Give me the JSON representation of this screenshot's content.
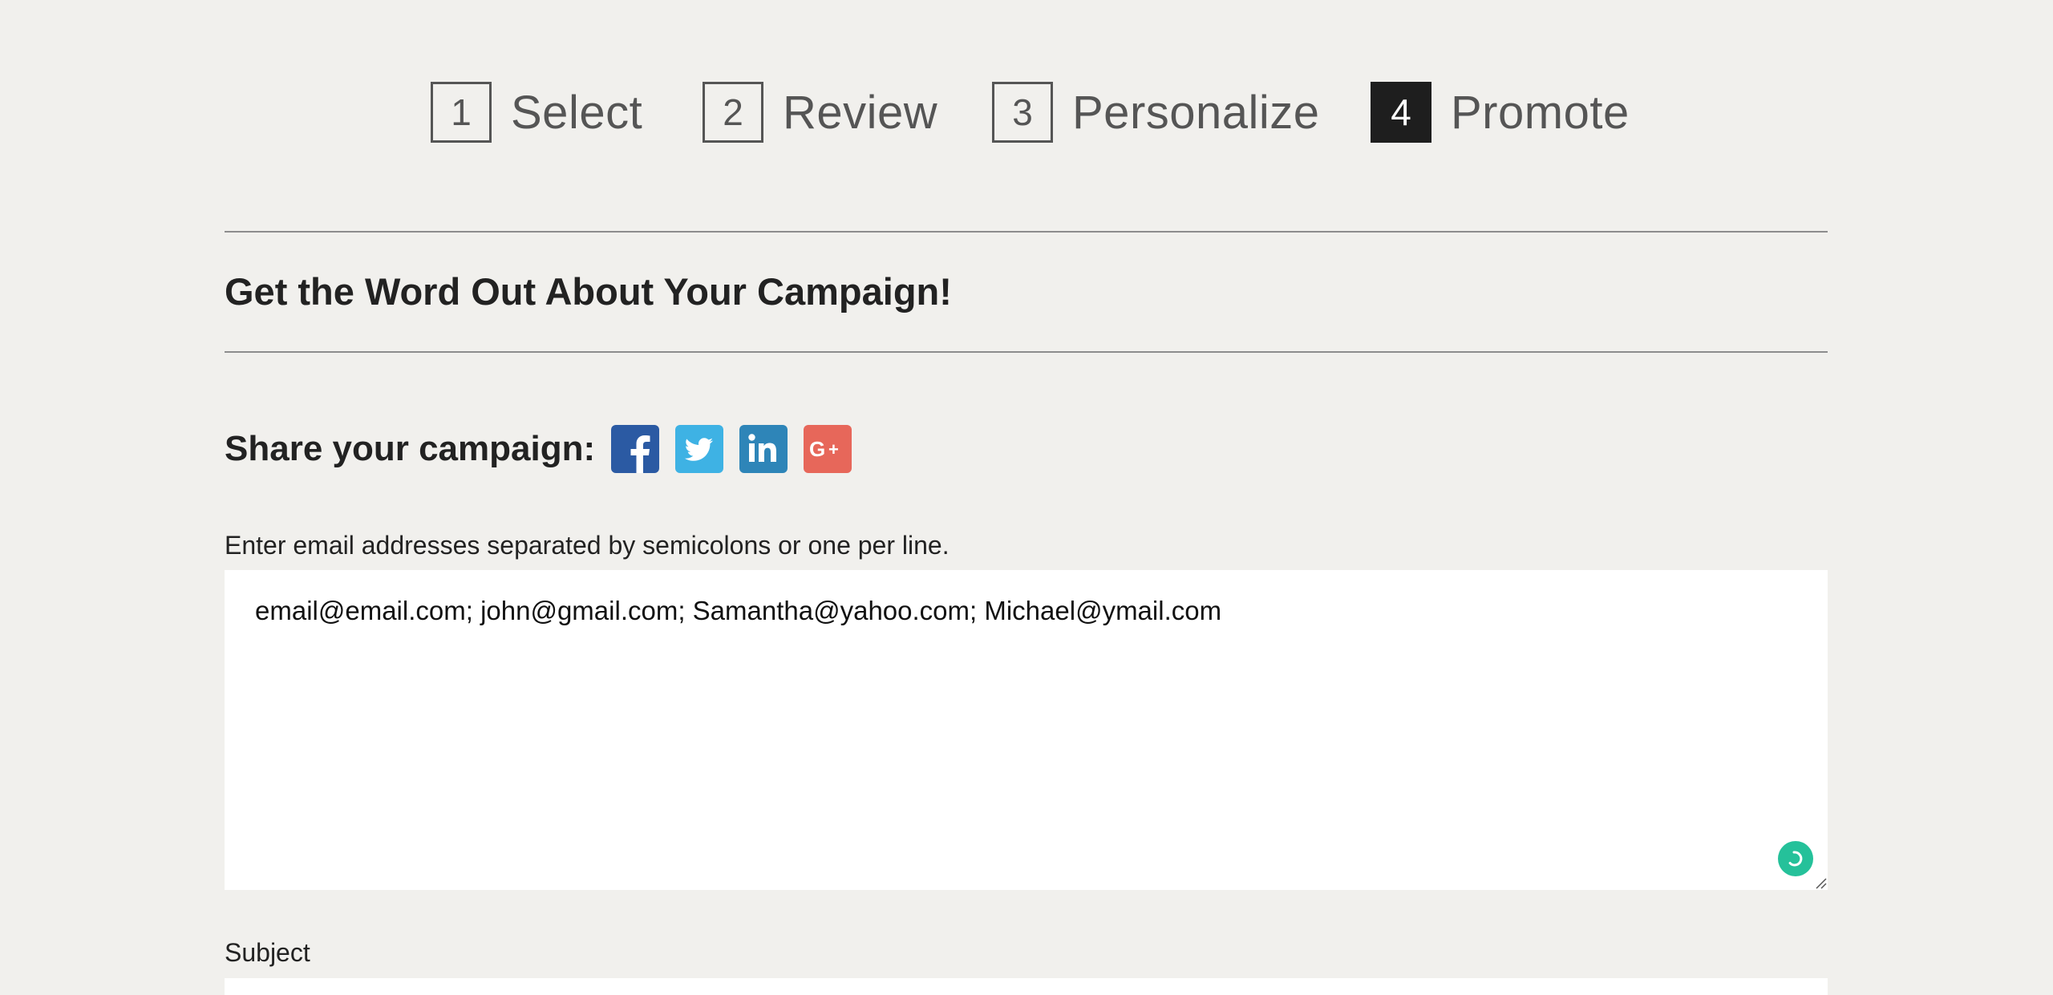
{
  "stepper": {
    "steps": [
      {
        "number": "1",
        "label": "Select"
      },
      {
        "number": "2",
        "label": "Review"
      },
      {
        "number": "3",
        "label": "Personalize"
      },
      {
        "number": "4",
        "label": "Promote"
      }
    ],
    "active_index": 3
  },
  "page_title": "Get the Word Out About Your Campaign!",
  "share": {
    "label": "Share your campaign:",
    "networks": [
      {
        "name": "facebook",
        "icon": "facebook-icon",
        "color": "#2b5aa3"
      },
      {
        "name": "twitter",
        "icon": "twitter-icon",
        "color": "#3eb2e4"
      },
      {
        "name": "linkedin",
        "icon": "linkedin-icon",
        "color": "#2e85b8"
      },
      {
        "name": "google-plus",
        "icon": "google-plus-icon",
        "color": "#e7675a"
      }
    ]
  },
  "email": {
    "label": "Enter email addresses separated by semicolons or one per line.",
    "value": "email@email.com; john@gmail.com; Samantha@yahoo.com; Michael@ymail.com"
  },
  "subject": {
    "label": "Subject"
  },
  "colors": {
    "background": "#f1f0ed",
    "active_step": "#1e1e1e",
    "grammarly": "#25c19a"
  }
}
